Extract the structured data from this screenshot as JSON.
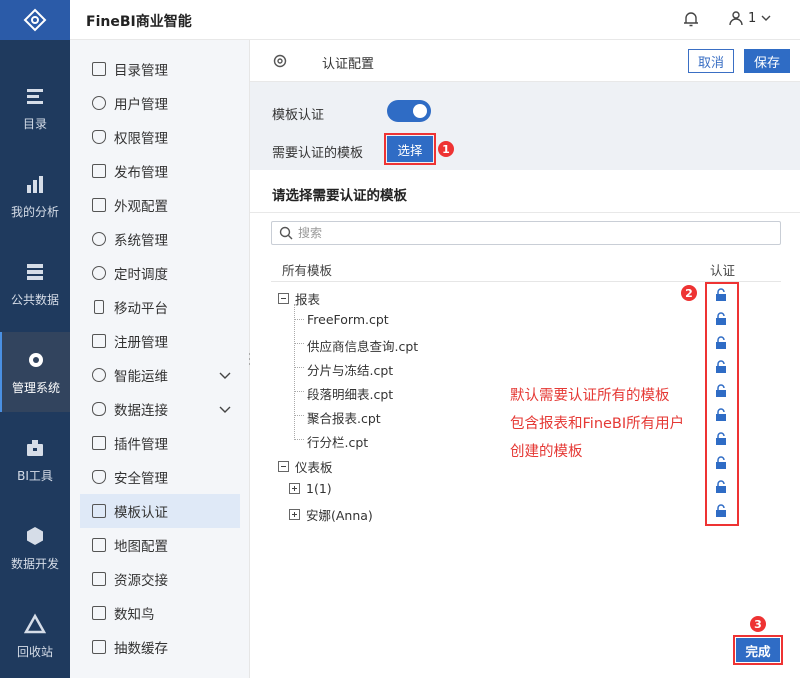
{
  "app": {
    "title": "FineBI商业智能",
    "user": "1"
  },
  "sidebar": {
    "items": [
      {
        "label": "目录",
        "icon": "catalog-icon"
      },
      {
        "label": "我的分析",
        "icon": "analysis-icon"
      },
      {
        "label": "公共数据",
        "icon": "public-data-icon"
      },
      {
        "label": "管理系统",
        "icon": "manage-system-icon",
        "active": true
      },
      {
        "label": "BI工具",
        "icon": "bi-tools-icon"
      },
      {
        "label": "数据开发",
        "icon": "data-dev-icon"
      },
      {
        "label": "回收站",
        "icon": "recycle-bin-icon"
      }
    ]
  },
  "menu": {
    "items": [
      {
        "label": "目录管理"
      },
      {
        "label": "用户管理"
      },
      {
        "label": "权限管理"
      },
      {
        "label": "发布管理"
      },
      {
        "label": "外观配置"
      },
      {
        "label": "系统管理"
      },
      {
        "label": "定时调度"
      },
      {
        "label": "移动平台"
      },
      {
        "label": "注册管理"
      },
      {
        "label": "智能运维",
        "expandable": true
      },
      {
        "label": "数据连接",
        "expandable": true
      },
      {
        "label": "插件管理"
      },
      {
        "label": "安全管理"
      },
      {
        "label": "模板认证",
        "active": true
      },
      {
        "label": "地图配置"
      },
      {
        "label": "资源交接"
      },
      {
        "label": "数知鸟"
      },
      {
        "label": "抽数缓存"
      }
    ]
  },
  "config": {
    "title": "认证配置",
    "cancel": "取消",
    "save": "保存",
    "template_auth_label": "模板认证",
    "template_auth_enabled": true,
    "need_auth_label": "需要认证的模板",
    "select_button": "选择",
    "badge1": "1"
  },
  "modal": {
    "title": "请选择需要认证的模板",
    "search_placeholder": "搜索",
    "col_all": "所有模板",
    "col_auth": "认证",
    "badge2": "2",
    "badge3": "3",
    "tree": {
      "report_folder": "报表",
      "reports": [
        "FreeForm.cpt",
        "供应商信息查询.cpt",
        "分片与冻结.cpt",
        "段落明细表.cpt",
        "聚合报表.cpt",
        "行分栏.cpt"
      ],
      "dashboard_folder": "仪表板",
      "dashboards": [
        "1(1)",
        "安娜(Anna)"
      ]
    },
    "annotation": [
      "默认需要认证所有的模板",
      "包含报表和FineBI所有用户",
      "创建的模板"
    ],
    "done": "完成"
  },
  "colors": {
    "sidebar": "#1f3a5e",
    "accent": "#2f6cc5",
    "highlight": "#e33333"
  }
}
